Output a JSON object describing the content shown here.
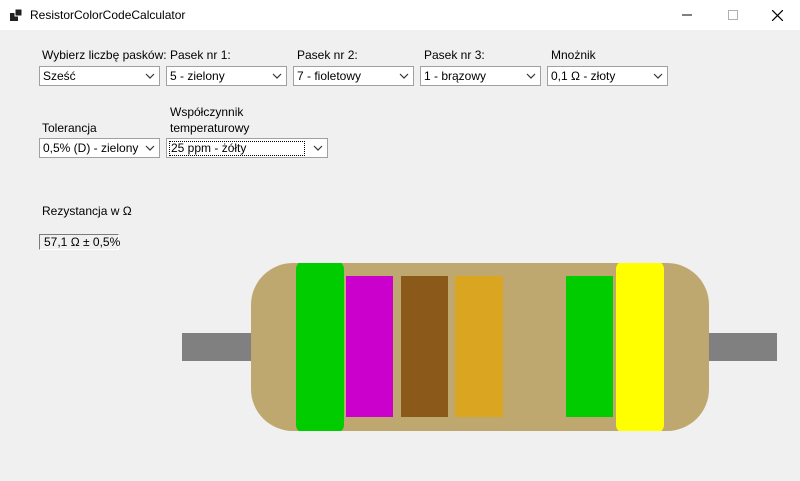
{
  "window": {
    "title": "ResistorColorCodeCalculator",
    "icon": "app-window-icon"
  },
  "labels": {
    "band_count": "Wybierz liczbę pasków:",
    "band1": "Pasek nr 1:",
    "band2": "Pasek nr 2:",
    "band3": "Pasek nr 3:",
    "multiplier": "Mnożnik",
    "tolerance": "Tolerancja",
    "temp_coeff_line1": "Współczynnik",
    "temp_coeff_line2": "temperaturowy",
    "resistance": "Rezystancja w Ω"
  },
  "selects": {
    "band_count": "Sześć",
    "band1": "5 - zielony",
    "band2": "7 - fioletowy",
    "band3": "1 - brązowy",
    "multiplier": "0,1 Ω - złoty",
    "tolerance": "0,5% (D) - zielony",
    "temp_coeff": "25 ppm - żółty"
  },
  "result": "57,1 Ω ± 0,5%",
  "colors": {
    "background": "#f0f0f0",
    "resistor_body": "#bfa870",
    "lead": "#808080",
    "band1": "#00cc00",
    "band2": "#cc00cc",
    "band3": "#8b5a1a",
    "multiplier": "#daa520",
    "tolerance": "#00cc00",
    "temp_coeff": "#ffff00"
  }
}
